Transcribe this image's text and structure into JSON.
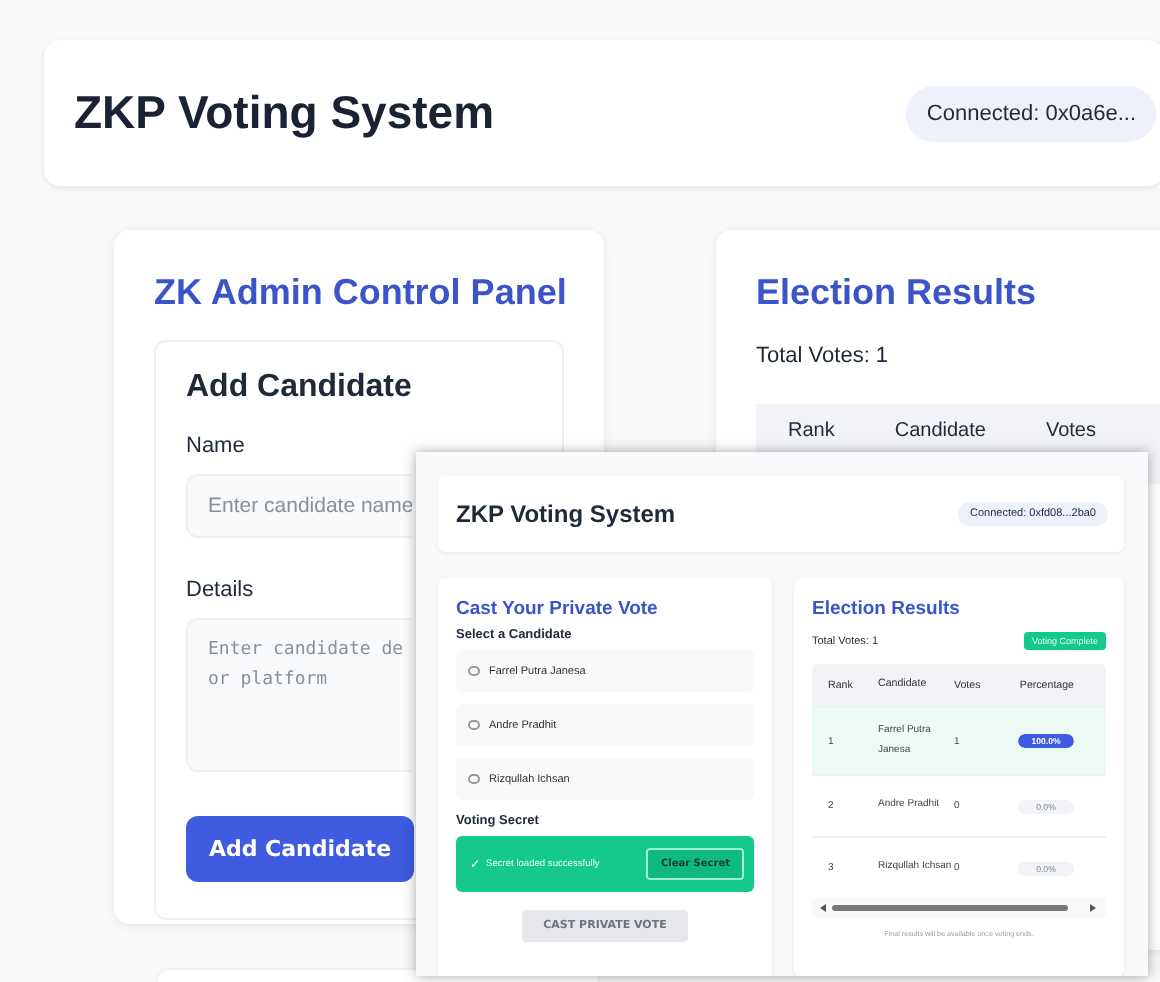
{
  "page": {
    "header": {
      "title": "ZKP Voting System",
      "wallet_badge": "Connected: 0x0a6e..."
    },
    "admin_panel": {
      "title": "ZK Admin Control Panel",
      "add_candidate": {
        "title": "Add Candidate",
        "name_label": "Name",
        "name_placeholder": "Enter candidate name",
        "details_label": "Details",
        "details_placeholder": "Enter candidate de\nor platform",
        "button": "Add Candidate"
      }
    },
    "results_panel": {
      "title": "Election Results",
      "total_votes": "Total Votes: 1",
      "columns": [
        "Rank",
        "Candidate",
        "Votes"
      ]
    }
  },
  "screenshot": {
    "header": {
      "title": "ZKP Voting System",
      "wallet_badge": "Connected: 0xfd08...2ba0"
    },
    "vote_panel": {
      "title": "Cast Your Private Vote",
      "select_label": "Select a Candidate",
      "candidates": [
        {
          "name": "Farrel Putra Janesa",
          "selected": false
        },
        {
          "name": "Andre Pradhit",
          "selected": false
        },
        {
          "name": "Rizqullah Ichsan",
          "selected": false
        }
      ],
      "secret_label": "Voting Secret",
      "secret_status": {
        "icon": "✓",
        "message": "Secret loaded successfully",
        "button": "Clear Secret"
      },
      "submit": {
        "label": "CAST PRIVATE VOTE",
        "disabled": true
      }
    },
    "results_panel": {
      "title": "Election Results",
      "total_votes": "Total Votes: 1",
      "status_badge": "Voting Complete",
      "columns": [
        "Rank",
        "Candidate",
        "Votes",
        "Percentage"
      ],
      "rows": [
        {
          "rank": "1",
          "candidate": "Farrel Putra Janesa",
          "votes": "1",
          "percentage": "100.0%",
          "level": 1,
          "highlighted": true
        },
        {
          "rank": "2",
          "candidate": "Andre Pradhit",
          "votes": "0",
          "percentage": "0.0%",
          "level": 0,
          "highlighted": false
        },
        {
          "rank": "3",
          "candidate": "Rizqullah Ichsan",
          "votes": "0",
          "percentage": "0.0%",
          "level": 0,
          "highlighted": false
        }
      ],
      "note": "Final results will be available once voting ends."
    }
  }
}
